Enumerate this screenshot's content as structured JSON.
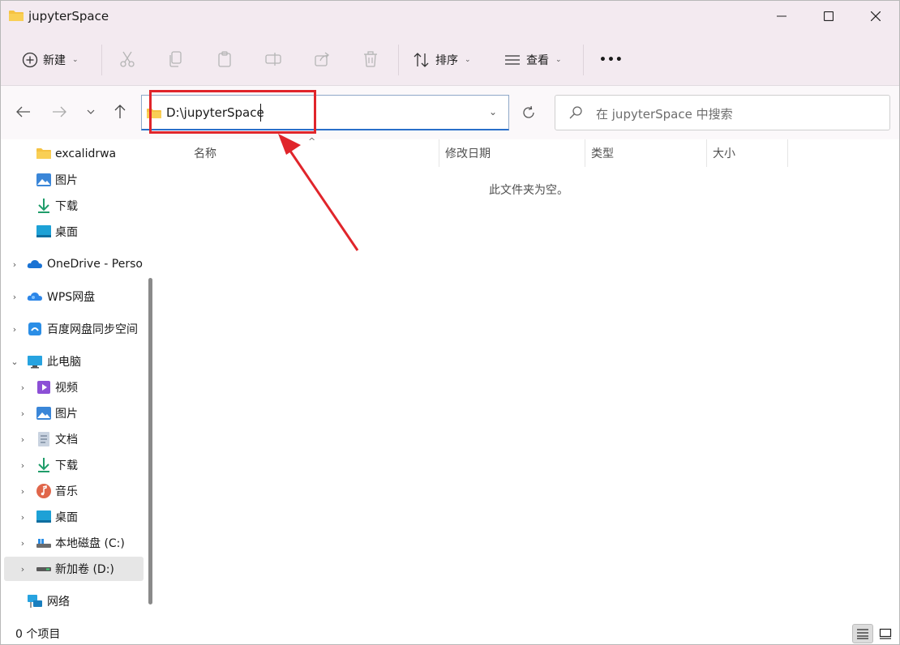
{
  "window": {
    "title": "jupyterSpace"
  },
  "toolbar": {
    "new_label": "新建",
    "sort_label": "排序",
    "view_label": "查看",
    "more_label": "•••"
  },
  "address": {
    "path": "D:\\jupyterSpace"
  },
  "search": {
    "placeholder": "在 jupyterSpace 中搜索"
  },
  "sidebar": {
    "items": [
      {
        "label": "excalidrwa",
        "icon": "folder-icon"
      },
      {
        "label": "图片",
        "icon": "pictures-icon"
      },
      {
        "label": "下载",
        "icon": "download-icon"
      },
      {
        "label": "桌面",
        "icon": "desktop-icon"
      },
      {
        "label": "OneDrive - Perso",
        "icon": "onedrive-icon"
      },
      {
        "label": "WPS网盘",
        "icon": "cloud-icon"
      },
      {
        "label": "百度网盘同步空间",
        "icon": "baidu-icon"
      },
      {
        "label": "此电脑",
        "icon": "this-pc-icon"
      },
      {
        "label": "视频",
        "icon": "videos-icon"
      },
      {
        "label": "图片",
        "icon": "pictures-icon"
      },
      {
        "label": "文档",
        "icon": "documents-icon"
      },
      {
        "label": "下载",
        "icon": "download-icon"
      },
      {
        "label": "音乐",
        "icon": "music-icon"
      },
      {
        "label": "桌面",
        "icon": "desktop-icon"
      },
      {
        "label": "本地磁盘 (C:)",
        "icon": "drive-icon"
      },
      {
        "label": "新加卷 (D:)",
        "icon": "drive-icon"
      },
      {
        "label": "网络",
        "icon": "network-icon"
      }
    ]
  },
  "columns": {
    "name": "名称",
    "modified": "修改日期",
    "type": "类型",
    "size": "大小"
  },
  "content": {
    "empty_message": "此文件夹为空。"
  },
  "status": {
    "item_count": "0 个项目"
  },
  "colors": {
    "accent": "#2a6fc9",
    "annotation": "#e0252b",
    "folder": "#f5c242"
  }
}
